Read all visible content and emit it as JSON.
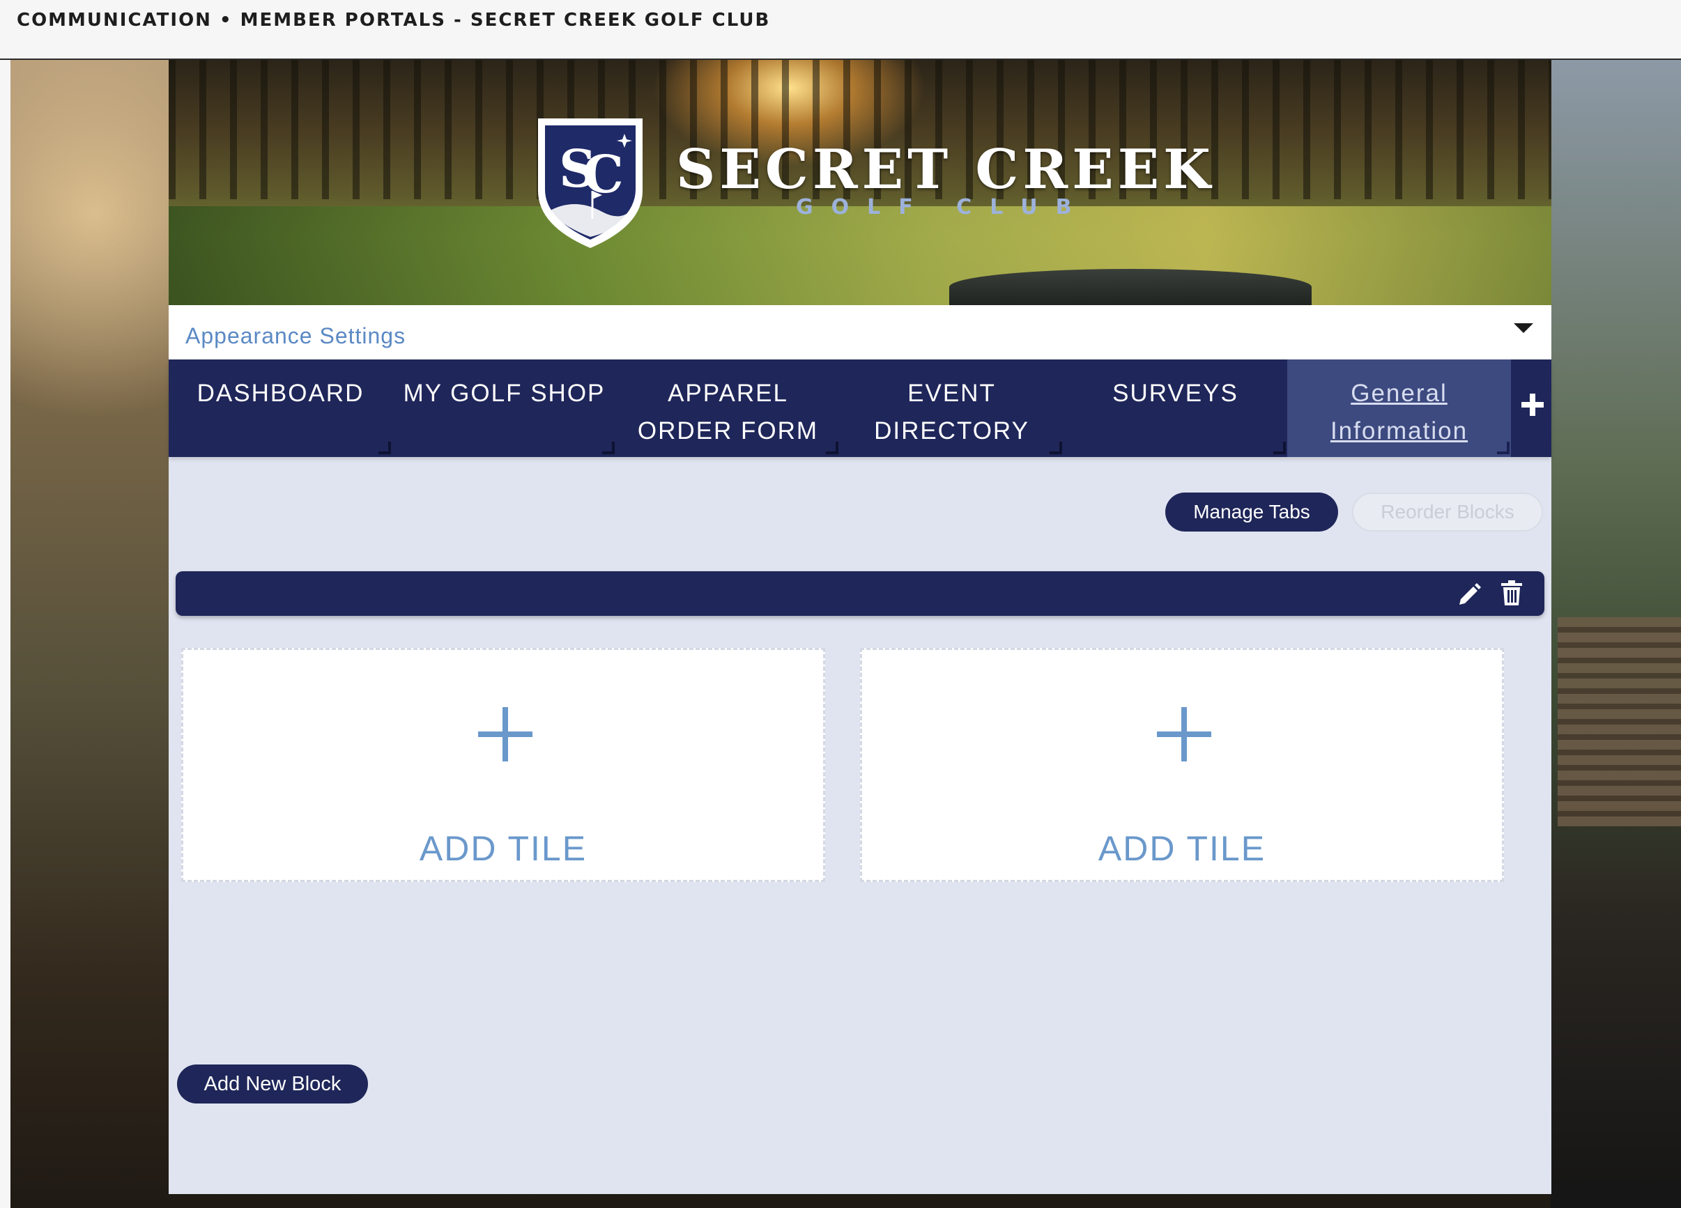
{
  "header": {
    "breadcrumb": "COMMUNICATION • MEMBER PORTALS - SECRET CREEK GOLF CLUB"
  },
  "banner": {
    "logo_title": "SECRET CREEK",
    "logo_subtitle": "GOLF CLUB",
    "crest_icon": "sc-crest-logo-icon"
  },
  "settings": {
    "label": "Appearance Settings",
    "toggle_icon": "caret-down-icon"
  },
  "tabs": [
    {
      "line1": "DASHBOARD",
      "line2": ""
    },
    {
      "line1": "MY GOLF SHOP",
      "line2": ""
    },
    {
      "line1": "APPAREL",
      "line2": "ORDER FORM"
    },
    {
      "line1": "EVENT",
      "line2": "DIRECTORY"
    },
    {
      "line1": "SURVEYS",
      "line2": ""
    },
    {
      "line1": "General",
      "line2": "Information"
    }
  ],
  "active_tab": "General Information",
  "actions": {
    "manage_tabs": "Manage Tabs",
    "reorder_blocks": "Reorder Blocks",
    "add_new_block": "Add New Block"
  },
  "tiles": [
    {
      "label": "ADD TILE"
    },
    {
      "label": "ADD TILE"
    }
  ],
  "colors": {
    "navy": "#1f2659",
    "active_tab": "#3d4a80",
    "accent_blue": "#6a98cb",
    "content_bg": "#e0e4f0"
  }
}
